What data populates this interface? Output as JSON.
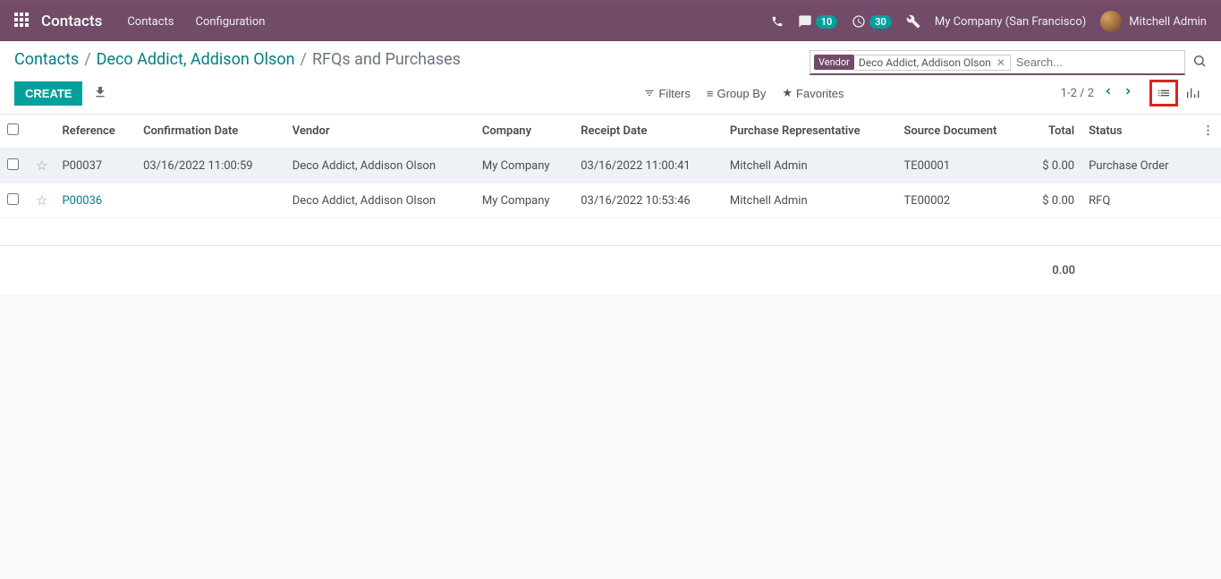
{
  "topbar": {
    "app_title": "Contacts",
    "nav": [
      "Contacts",
      "Configuration"
    ],
    "badge_messages": "10",
    "badge_activities": "30",
    "company": "My Company (San Francisco)",
    "user": "Mitchell Admin"
  },
  "breadcrumb": {
    "root": "Contacts",
    "contact": "Deco Addict, Addison Olson",
    "current": "RFQs and Purchases"
  },
  "search": {
    "facet_label": "Vendor",
    "facet_value": "Deco Addict, Addison Olson",
    "placeholder": "Search..."
  },
  "controls": {
    "create": "CREATE",
    "filters": "Filters",
    "groupby": "Group By",
    "favorites": "Favorites",
    "pager": "1-2 / 2"
  },
  "columns": {
    "reference": "Reference",
    "confirmation_date": "Confirmation Date",
    "vendor": "Vendor",
    "company": "Company",
    "receipt_date": "Receipt Date",
    "rep": "Purchase Representative",
    "source": "Source Document",
    "total": "Total",
    "status": "Status"
  },
  "rows": [
    {
      "reference": "P00037",
      "reference_is_link": false,
      "confirmation_date": "03/16/2022 11:00:59",
      "vendor": "Deco Addict, Addison Olson",
      "company": "My Company",
      "receipt_date": "03/16/2022 11:00:41",
      "rep": "Mitchell Admin",
      "source": "TE00001",
      "total": "$ 0.00",
      "status": "Purchase Order",
      "selected": true
    },
    {
      "reference": "P00036",
      "reference_is_link": true,
      "confirmation_date": "",
      "vendor": "Deco Addict, Addison Olson",
      "company": "My Company",
      "receipt_date": "03/16/2022 10:53:46",
      "rep": "Mitchell Admin",
      "source": "TE00002",
      "total": "$ 0.00",
      "status": "RFQ",
      "selected": false
    }
  ],
  "footer": {
    "total": "0.00"
  }
}
